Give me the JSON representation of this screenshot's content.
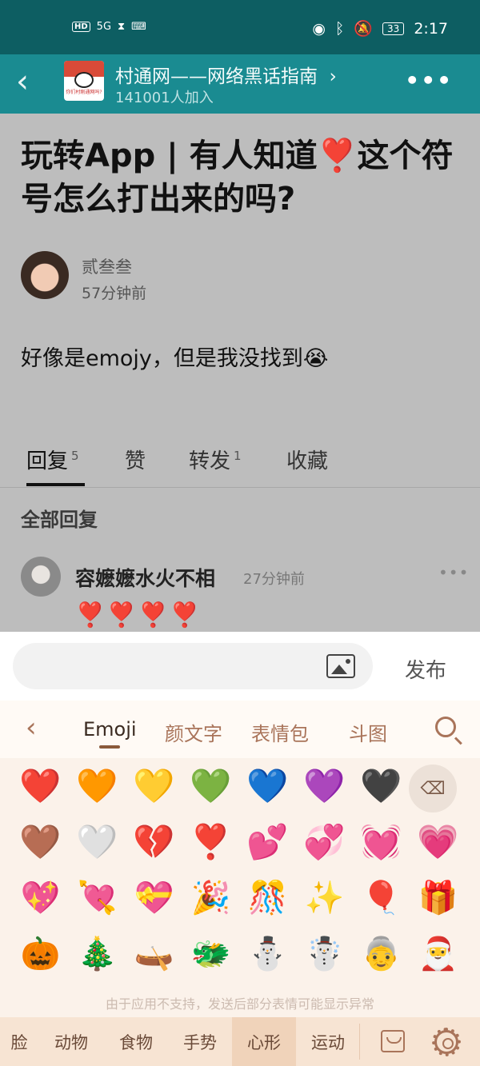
{
  "status_bar": {
    "left_badges": [
      "HD",
      "5G",
      "⧗",
      "⌨"
    ],
    "time": "2:17",
    "battery": "33",
    "icons": [
      "eye-icon",
      "bluetooth-icon",
      "mute-icon"
    ]
  },
  "group": {
    "name": "村通网——网络黑话指南",
    "members": "141001人加入",
    "avatar_caption": "你们村刚通网吗?"
  },
  "post": {
    "title_part1": "玩转App | 有人知道",
    "title_heart": "❣️",
    "title_part2": "这个符号怎么打出来的吗?",
    "author": "贰叁叁",
    "time": "57分钟前",
    "body": "好像是emojy，但是我没找到😭"
  },
  "tabs": [
    {
      "label": "回复",
      "count": "5"
    },
    {
      "label": "赞",
      "count": ""
    },
    {
      "label": "转发",
      "count": "1"
    },
    {
      "label": "收藏",
      "count": ""
    }
  ],
  "replies": {
    "heading": "全部回复",
    "items": [
      {
        "author": "容嬷嬷水火不相",
        "time": "27分钟前",
        "content": "❣️❣️❣️❣️"
      }
    ]
  },
  "composer": {
    "placeholder": "",
    "publish_label": "发布"
  },
  "keyboard": {
    "tabs": [
      "Emoji",
      "颜文字",
      "表情包",
      "斗图"
    ],
    "active_tab": "Emoji",
    "emoji_rows": [
      [
        "❤️",
        "🧡",
        "💛",
        "💚",
        "💙",
        "💜",
        "🖤"
      ],
      [
        "🤎",
        "🤍",
        "💔",
        "❣️",
        "💕",
        "💞",
        "💓",
        "💗"
      ],
      [
        "💖",
        "💘",
        "💝",
        "🎉",
        "🎊",
        "✨",
        "🎈",
        "🎁"
      ],
      [
        "🎃",
        "🎄",
        "🛶",
        "🐲",
        "⛄",
        "☃️",
        "👵",
        "🎅"
      ]
    ],
    "hint": "由于应用不支持，发送后部分表情可能显示异常",
    "categories": [
      "脸",
      "动物",
      "食物",
      "手势",
      "心形",
      "运动"
    ],
    "active_category": "心形",
    "colors": {
      "accent": "#a9745a",
      "panel": "#fbf2ea"
    }
  }
}
